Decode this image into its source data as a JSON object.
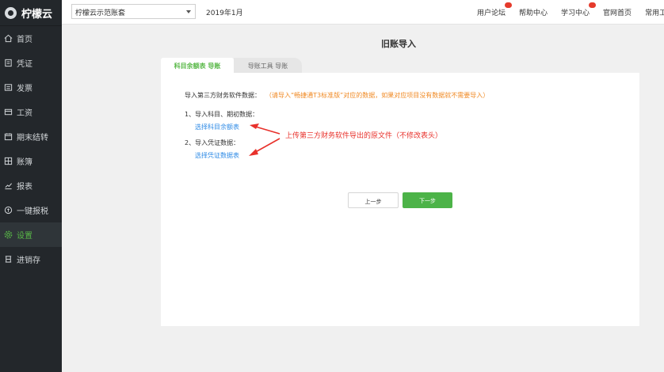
{
  "sidebar": {
    "brand": "柠檬云",
    "items": [
      {
        "label": "首页",
        "icon": "home-icon"
      },
      {
        "label": "凭证",
        "icon": "voucher-icon"
      },
      {
        "label": "发票",
        "icon": "invoice-icon"
      },
      {
        "label": "工资",
        "icon": "salary-icon"
      },
      {
        "label": "期末结转",
        "icon": "calendar-icon"
      },
      {
        "label": "账簿",
        "icon": "ledger-icon"
      },
      {
        "label": "报表",
        "icon": "chart-icon"
      },
      {
        "label": "一键报税",
        "icon": "tax-icon"
      },
      {
        "label": "设置",
        "icon": "gear-icon"
      },
      {
        "label": "进销存",
        "icon": "inventory-icon"
      }
    ],
    "active_item": "设置"
  },
  "topbar": {
    "account_value": "柠檬云示范账套",
    "period": "2019年1月",
    "links": [
      "用户论坛",
      "帮助中心",
      "学习中心",
      "官网首页",
      "常用工具"
    ]
  },
  "main": {
    "title": "旧账导入",
    "tabs": [
      "科目余额表 导账",
      "导账工具 导账"
    ],
    "import_label": "导入第三方财务软件数据：",
    "import_tip": "（请导入“畅捷通T3标准版”对应的数据，如果对应项目没有数据就不需要导入）",
    "step1_label": "1、导入科目、期初数据：",
    "step1_link": "选择科目余额表",
    "step2_label": "2、导入凭证数据：",
    "step2_link": "选择凭证数据表",
    "annotation": "上传第三方财务软件导出的原文件（不修改表头）",
    "prev_button": "上一步",
    "next_button": "下一步"
  },
  "colors": {
    "sidebar_bg": "#23272b",
    "accent_green": "#58b847",
    "link_blue": "#2f8be6",
    "tip_orange": "#f08a24",
    "annotation_red": "#e8312b"
  }
}
